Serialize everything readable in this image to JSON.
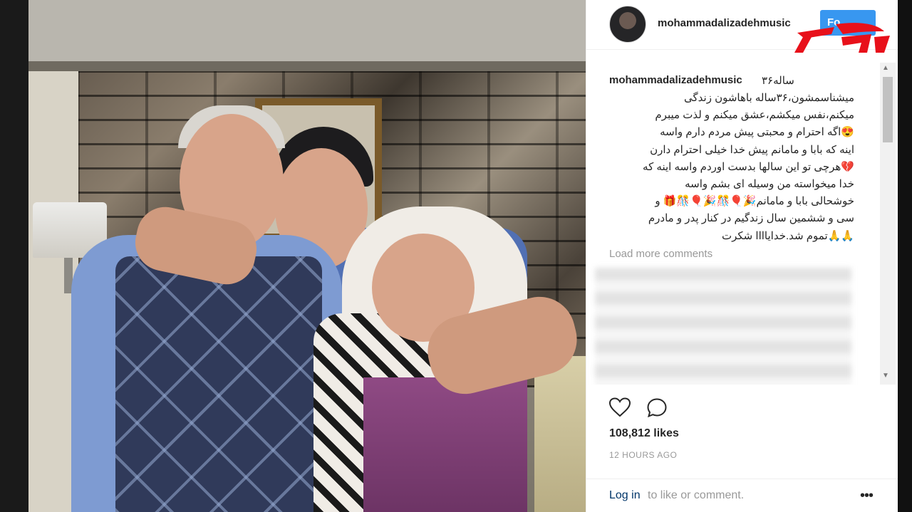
{
  "post": {
    "username": "mohammadalizadehmusic",
    "follow_label": "Fo",
    "caption_username": "mohammadalizadehmusic",
    "caption_age": "۳۶ساله",
    "caption_text": "میشناسمشون،۳۶ساله باهاشون زندگی\nمیکنم،نفس میکشم،عشق میکنم و لذت میبرم\n😍اگه احترام و محبتی پیش مردم دارم واسه\nاینه که بابا و مامانم پیش خدا خیلی احترام دارن\n💔هرچی تو این سالها بدست اوردم واسه اینه که\nخدا میخواسته من وسیله ای بشم واسه\nخوشحالی بابا و مامانم🎉🎈🎊🎉🎈🎊🎁 و\nسی و ششمین سال زندگیم در کنار پدر و مادرم\n🙏🙏تموم شد.خدایاااا شکرت",
    "load_more": "Load more comments",
    "likes": "108,812 likes",
    "time": "12 HOURS AGO",
    "login_link": "Log in",
    "login_rest": "to like or comment.",
    "more": "•••"
  },
  "icons": {
    "like": "heart-icon",
    "comment": "comment-bubble-icon",
    "more": "more-options-icon"
  },
  "colors": {
    "follow": "#3897f0",
    "logo": "#e8101a",
    "login_link": "#003569"
  }
}
